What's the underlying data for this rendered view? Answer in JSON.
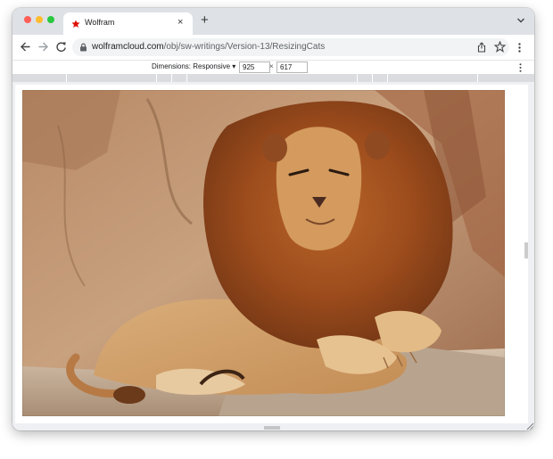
{
  "browser": {
    "tab": {
      "title": "Wolfram",
      "close_glyph": "×"
    },
    "new_tab_glyph": "+",
    "address": {
      "host": "wolframcloud.com",
      "path": "/obj/sw-writings/Version-13/ResizingCats"
    }
  },
  "devtools": {
    "dimensions_label": "Dimensions: Responsive ▾",
    "width": "925",
    "height": "617",
    "times_glyph": "×"
  },
  "content": {
    "image_subject": "lion lying on a rock"
  },
  "colors": {
    "tab_strip": "#dee1e6",
    "close_red": "#fe5f57",
    "minimize_yellow": "#febc2e",
    "zoom_green": "#28c840",
    "favicon_red": "#dd1100",
    "ruler": "#dadce0"
  },
  "icons": [
    "wolfram-favicon",
    "back-arrow-icon",
    "forward-arrow-icon",
    "reload-icon",
    "lock-icon",
    "share-icon",
    "star-icon",
    "more-vert-icon",
    "chevron-down-icon",
    "resize-handle-icon"
  ]
}
